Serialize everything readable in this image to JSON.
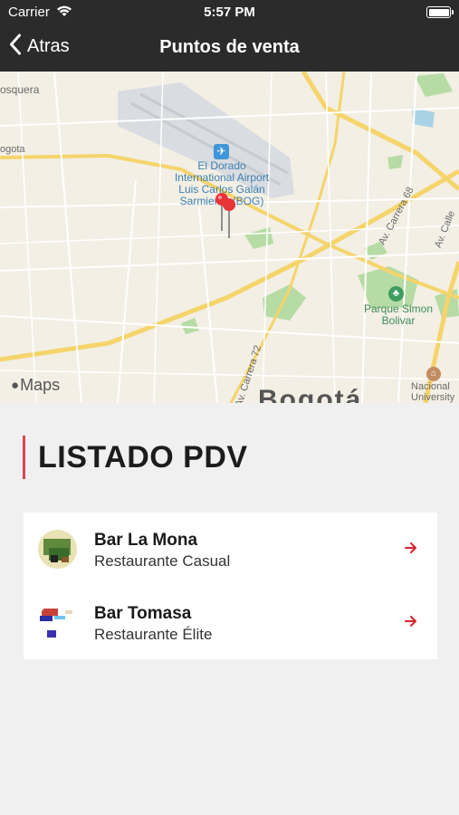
{
  "status_bar": {
    "carrier": "Carrier",
    "time": "5:57 PM"
  },
  "nav": {
    "back_label": "Atras",
    "title": "Puntos de venta"
  },
  "map": {
    "labels": {
      "mosquera": "osquera",
      "bogota_road": "ogota",
      "airport": "El Dorado International Airport Luis Carlos Galán Sarmiento (BOG)",
      "carrera68": "Av. Carrera 68",
      "calle": "Av. Calle",
      "park": "Parque Simon Bolivar",
      "carrera72": "Av. Carrera 72",
      "university": "Nacional University o",
      "city": "Bogotá"
    },
    "logo_text": "Maps"
  },
  "section": {
    "title": "LISTADO PDV",
    "accent_color": "#d9454d"
  },
  "pdv_list": [
    {
      "name": "Bar La Mona",
      "type": "Restaurante Casual"
    },
    {
      "name": "Bar Tomasa",
      "type": "Restaurante Élite"
    }
  ],
  "colors": {
    "nav_background": "#2b2b2b",
    "arrow": "#d8222b",
    "page_background": "#f0f0f1"
  },
  "icons": {
    "back": "chevron-left-icon",
    "wifi": "wifi-icon",
    "battery": "battery-icon",
    "row_action": "arrow-right-icon",
    "pin": "map-pin-icon"
  }
}
